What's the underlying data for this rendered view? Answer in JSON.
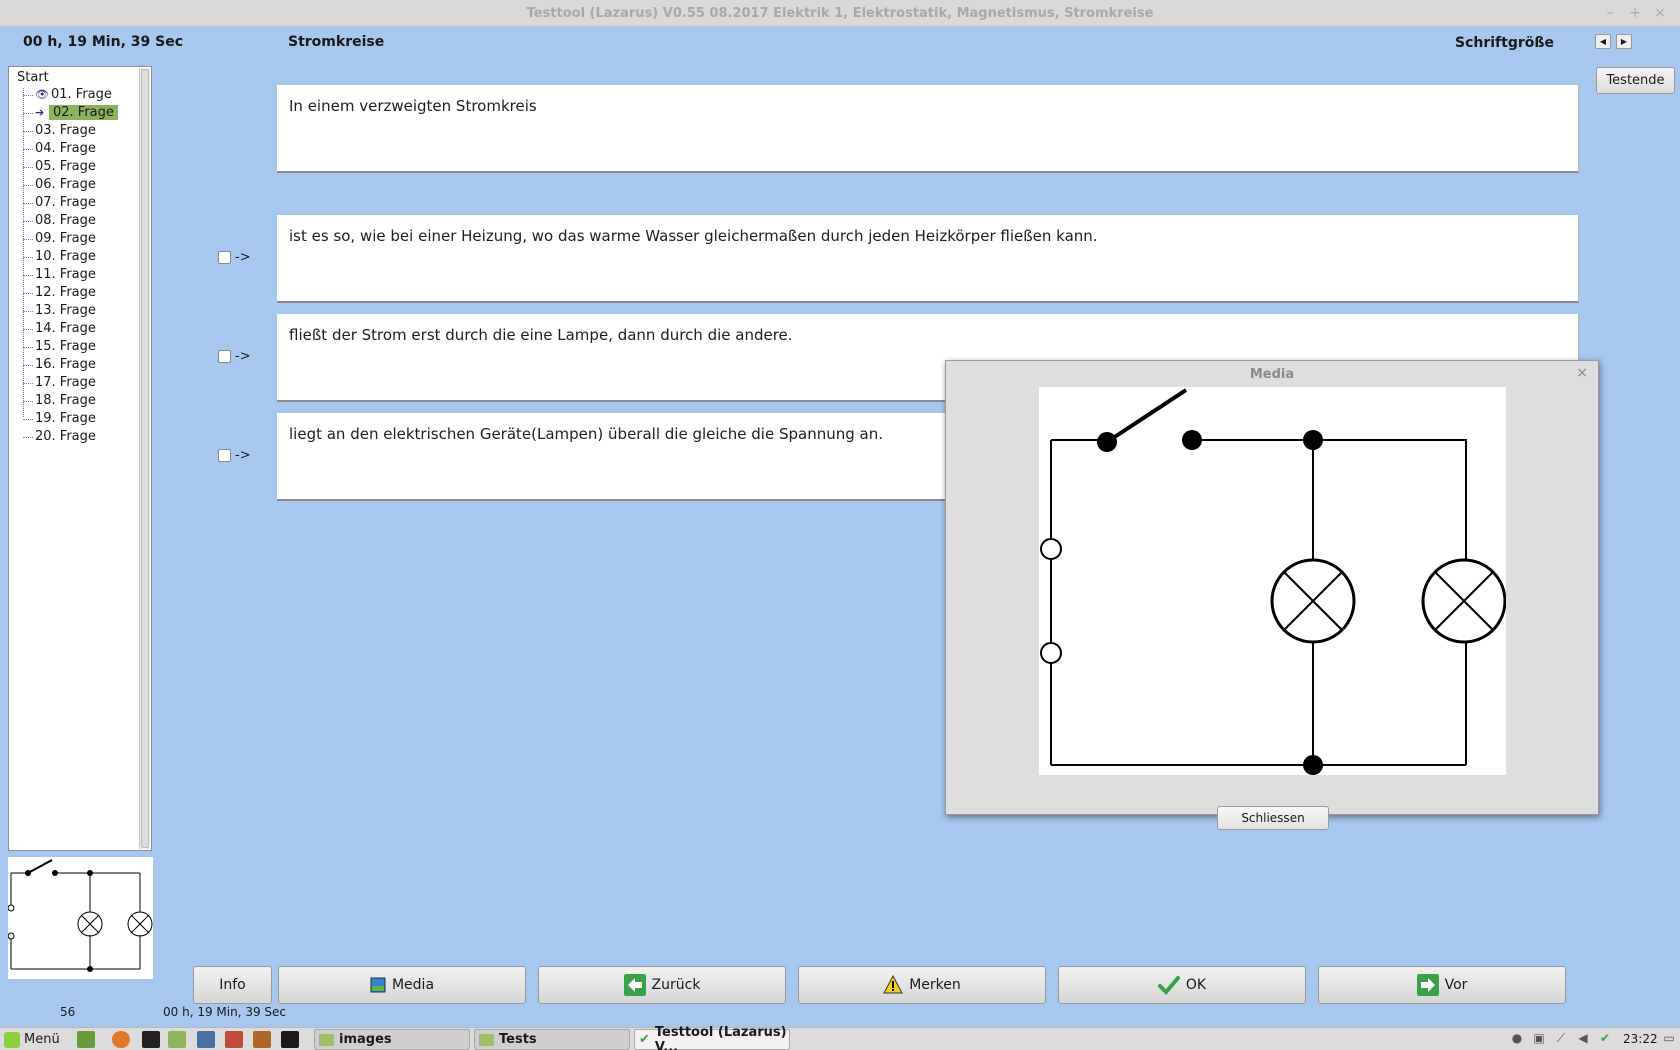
{
  "window": {
    "title": "Testtool (Lazarus) V0.55 08.2017 Elektrik 1, Elektrostatik, Magnetismus, Stromkreise",
    "minimize": "–",
    "maximize": "+",
    "close": "×"
  },
  "header": {
    "timer": "00 h, 19 Min, 39 Sec",
    "topic": "Stromkreise",
    "font_size_label": "Schriftgröße",
    "font_prev": "◀",
    "font_next": "▶",
    "end_test": "Testende"
  },
  "tree": {
    "root": "Start",
    "items": [
      {
        "label": "01. Frage",
        "state": "seen"
      },
      {
        "label": "02. Frage",
        "state": "current"
      },
      {
        "label": "03. Frage"
      },
      {
        "label": "04. Frage"
      },
      {
        "label": "05. Frage"
      },
      {
        "label": "06. Frage"
      },
      {
        "label": "07. Frage"
      },
      {
        "label": "08. Frage"
      },
      {
        "label": "09. Frage"
      },
      {
        "label": "10. Frage"
      },
      {
        "label": "11. Frage"
      },
      {
        "label": "12. Frage"
      },
      {
        "label": "13. Frage"
      },
      {
        "label": "14. Frage"
      },
      {
        "label": "15. Frage"
      },
      {
        "label": "16. Frage"
      },
      {
        "label": "17. Frage"
      },
      {
        "label": "18. Frage"
      },
      {
        "label": "19. Frage"
      },
      {
        "label": "20. Frage"
      }
    ]
  },
  "question": {
    "stem": "In einem verzweigten Stromkreis",
    "arrow": "->",
    "answers": [
      {
        "text": "ist es so, wie bei einer Heizung, wo das warme Wasser gleichermaßen durch jeden Heizkörper fließen kann.",
        "checked": false
      },
      {
        "text": "fließt der Strom erst durch die eine Lampe, dann durch die andere.",
        "checked": false
      },
      {
        "text": "liegt an den elektrischen Geräte(Lampen) überall die gleiche die Spannung an.",
        "checked": false
      }
    ]
  },
  "media_dialog": {
    "title": "Media",
    "close": "×",
    "close_button": "Schliessen"
  },
  "buttons": {
    "info": "Info",
    "media": "Media",
    "back": "Zurück",
    "mark": "Merken",
    "ok": "OK",
    "next": "Vor"
  },
  "status": {
    "number": "56",
    "time": "00 h, 19 Min, 39 Sec"
  },
  "taskbar": {
    "menu": "Menü",
    "tasks": [
      "images",
      "Tests",
      "Testtool (Lazarus) V..."
    ],
    "clock": "23:22"
  },
  "colors": {
    "background": "#a7c7ee",
    "selected_item": "#8db25b",
    "back_icon": "#3aa04a",
    "ok_check": "#3aa04a",
    "warning_icon": "#f2d21a"
  }
}
